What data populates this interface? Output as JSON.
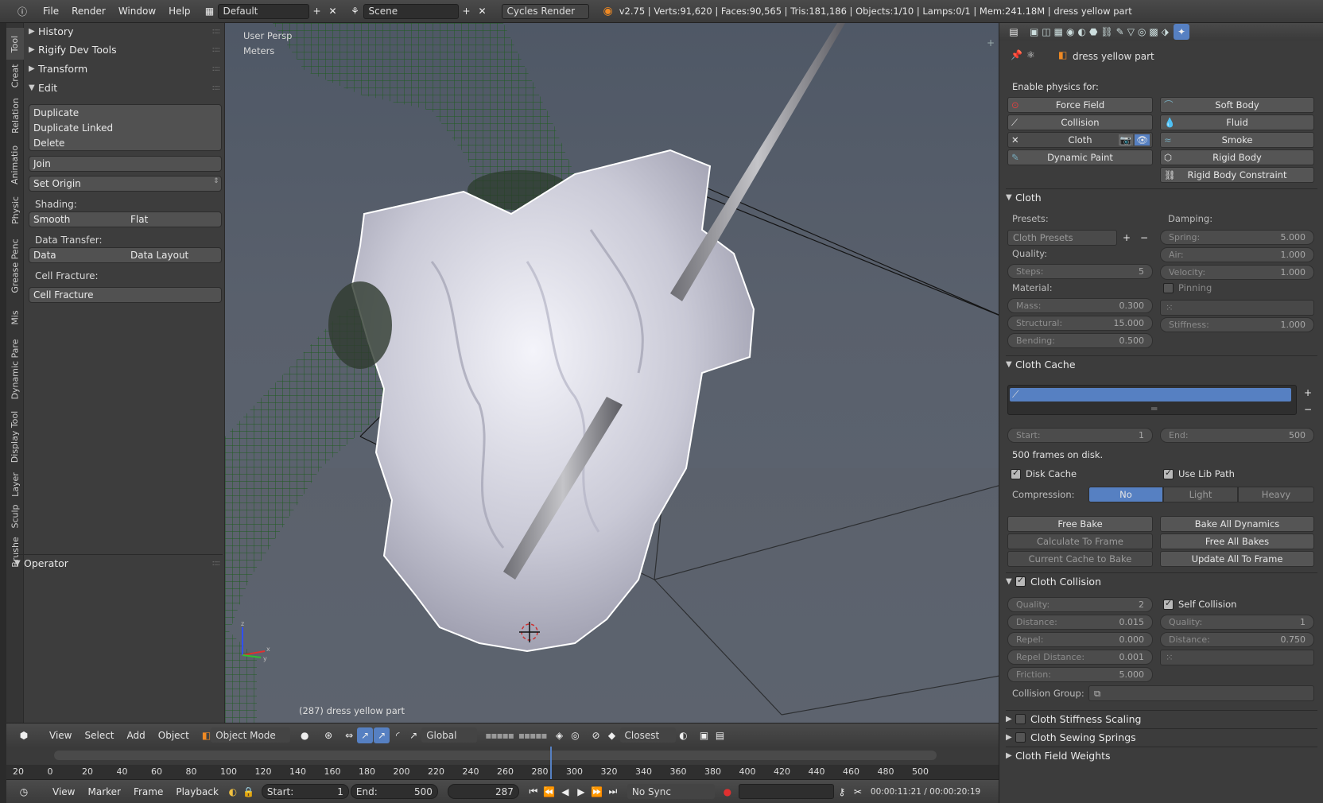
{
  "topbar": {
    "menus": [
      "File",
      "Render",
      "Window",
      "Help"
    ],
    "layout": "Default",
    "scene": "Scene",
    "engine": "Cycles Render",
    "stats": "v2.75 | Verts:91,620 | Faces:90,565 | Tris:181,186 | Objects:1/10 | Lamps:0/1 | Mem:241.18M | dress yellow part"
  },
  "tabs": [
    "Tool",
    "Creat",
    "Relation",
    "Animatio",
    "Physic",
    "Grease Penc",
    "Mis",
    "Dynamic Pare",
    "Display Tool",
    "Layer",
    "Sculp",
    "Brushe"
  ],
  "toolshelf": {
    "history": "History",
    "rigify": "Rigify Dev Tools",
    "transform": "Transform",
    "edit": "Edit",
    "duplicate": "Duplicate",
    "duplicate_linked": "Duplicate Linked",
    "delete": "Delete",
    "join": "Join",
    "set_origin": "Set Origin",
    "shading": "Shading:",
    "smooth": "Smooth",
    "flat": "Flat",
    "data_transfer": "Data Transfer:",
    "data": "Data",
    "data_layout": "Data Layout",
    "cell_fracture_label": "Cell Fracture:",
    "cell_fracture": "Cell Fracture",
    "operator": "Operator"
  },
  "viewport": {
    "view_name": "User Persp",
    "units": "Meters",
    "object_label": "(287) dress yellow part"
  },
  "vheader": {
    "menus": [
      "View",
      "Select",
      "Add",
      "Object"
    ],
    "mode": "Object Mode",
    "orientation": "Global",
    "snap": "Closest"
  },
  "timeline": {
    "ticks": [
      "20",
      "0",
      "20",
      "40",
      "60",
      "80",
      "100",
      "120",
      "140",
      "160",
      "180",
      "200",
      "220",
      "240",
      "260",
      "280",
      "300",
      "320",
      "340",
      "360",
      "380",
      "400",
      "420",
      "440",
      "460",
      "480",
      "500"
    ],
    "current_frame_pct": 0.57
  },
  "tlheader": {
    "menus": [
      "View",
      "Marker",
      "Frame",
      "Playback"
    ],
    "start_label": "Start:",
    "start": "1",
    "end_label": "End:",
    "end": "500",
    "frame": "287",
    "sync": "No Sync",
    "timecode": "00:00:11:21 / 00:00:20:19"
  },
  "props": {
    "object_name": "dress yellow part",
    "enable_physics": "Enable physics for:",
    "physics_buttons_left": [
      "Force Field",
      "Collision",
      "Cloth",
      "Dynamic Paint"
    ],
    "physics_buttons_right": [
      "Soft Body",
      "Fluid",
      "Smoke",
      "Rigid Body",
      "Rigid Body Constraint"
    ],
    "cloth": {
      "title": "Cloth",
      "presets_label": "Presets:",
      "presets": "Cloth Presets",
      "damping_label": "Damping:",
      "quality_label": "Quality:",
      "steps_label": "Steps:",
      "steps": "5",
      "material_label": "Material:",
      "mass_label": "Mass:",
      "mass": "0.300",
      "structural_label": "Structural:",
      "structural": "15.000",
      "bending_label": "Bending:",
      "bending": "0.500",
      "spring_label": "Spring:",
      "spring": "5.000",
      "air_label": "Air:",
      "air": "1.000",
      "velocity_label": "Velocity:",
      "velocity": "1.000",
      "pinning": "Pinning",
      "stiffness_label": "Stiffness:",
      "stiffness": "1.000"
    },
    "cache": {
      "title": "Cloth Cache",
      "start_label": "Start:",
      "start": "1",
      "end_label": "End:",
      "end": "500",
      "frames_on_disk": "500 frames on disk.",
      "disk_cache": "Disk Cache",
      "use_lib_path": "Use Lib Path",
      "compression_label": "Compression:",
      "compression_options": [
        "No",
        "Light",
        "Heavy"
      ],
      "free_bake": "Free Bake",
      "bake_all": "Bake All Dynamics",
      "calc_to_frame": "Calculate To Frame",
      "free_all": "Free All Bakes",
      "current_cache": "Current Cache to Bake",
      "update_all": "Update All To Frame"
    },
    "collision": {
      "title": "Cloth Collision",
      "quality_label": "Quality:",
      "quality": "2",
      "distance_label": "Distance:",
      "distance": "0.015",
      "repel_label": "Repel:",
      "repel": "0.000",
      "repel_distance_label": "Repel Distance:",
      "repel_distance": "0.001",
      "friction_label": "Friction:",
      "friction": "5.000",
      "self_collision": "Self Collision",
      "self_quality_label": "Quality:",
      "self_quality": "1",
      "self_distance_label": "Distance:",
      "self_distance": "0.750",
      "collision_group": "Collision Group:"
    },
    "stiffness_scaling": "Cloth Stiffness Scaling",
    "sewing_springs": "Cloth Sewing Springs",
    "field_weights": "Cloth Field Weights"
  },
  "colors": {
    "accent_blue": "#5680c2",
    "wire_green": "#1f5a1f",
    "cloth": "#d8d8e4"
  }
}
